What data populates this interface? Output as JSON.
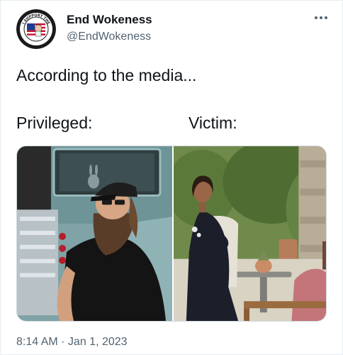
{
  "author": {
    "display_name": "End Wokeness",
    "handle": "@EndWokeness",
    "avatar_text_top": "I SUPPORT THE",
    "avatar_text_bottom": "FORMER THING"
  },
  "tweet": {
    "text": "According to the media...",
    "label_left": "Privileged:",
    "label_right": "Victim:"
  },
  "footer": {
    "timestamp": "8:14 AM · Jan 1, 2023"
  },
  "icons": {
    "more": "more-horizontal-icon"
  },
  "colors": {
    "text_primary": "#0f1419",
    "text_secondary": "#536471",
    "border": "#cfd9de"
  }
}
